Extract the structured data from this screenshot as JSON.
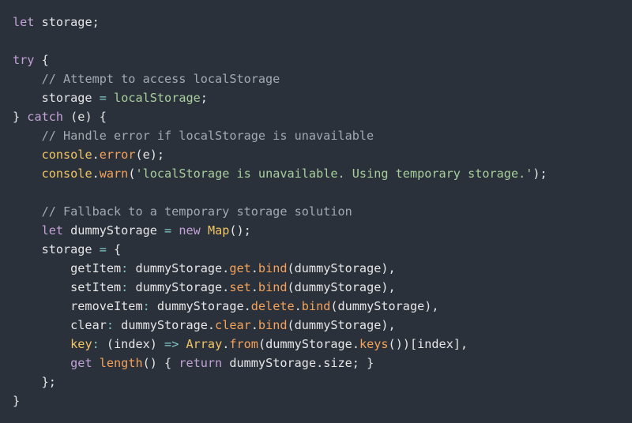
{
  "code": {
    "lines": [
      [
        {
          "t": "let",
          "c": "kw"
        },
        {
          "t": " storage;",
          "c": "pun"
        }
      ],
      [],
      [
        {
          "t": "try",
          "c": "kw"
        },
        {
          "t": " {",
          "c": "pun"
        }
      ],
      [
        {
          "t": "    "
        },
        {
          "t": "// Attempt to access localStorage",
          "c": "cm"
        }
      ],
      [
        {
          "t": "    storage ",
          "c": "ident"
        },
        {
          "t": "=",
          "c": "op"
        },
        {
          "t": " "
        },
        {
          "t": "localStorage",
          "c": "str"
        },
        {
          "t": ";",
          "c": "pun"
        }
      ],
      [
        {
          "t": "} ",
          "c": "pun"
        },
        {
          "t": "catch",
          "c": "kw"
        },
        {
          "t": " (e) {",
          "c": "pun"
        }
      ],
      [
        {
          "t": "    "
        },
        {
          "t": "// Handle error if localStorage is unavailable",
          "c": "cm"
        }
      ],
      [
        {
          "t": "    "
        },
        {
          "t": "console",
          "c": "ty"
        },
        {
          "t": ".",
          "c": "pun"
        },
        {
          "t": "error",
          "c": "fn"
        },
        {
          "t": "(e);",
          "c": "pun"
        }
      ],
      [
        {
          "t": "    "
        },
        {
          "t": "console",
          "c": "ty"
        },
        {
          "t": ".",
          "c": "pun"
        },
        {
          "t": "warn",
          "c": "fn"
        },
        {
          "t": "(",
          "c": "pun"
        },
        {
          "t": "'localStorage is unavailable. Using temporary storage.'",
          "c": "str"
        },
        {
          "t": ");",
          "c": "pun"
        }
      ],
      [],
      [
        {
          "t": "    "
        },
        {
          "t": "// Fallback to a temporary storage solution",
          "c": "cm"
        }
      ],
      [
        {
          "t": "    "
        },
        {
          "t": "let",
          "c": "kw"
        },
        {
          "t": " dummyStorage ",
          "c": "ident"
        },
        {
          "t": "=",
          "c": "op"
        },
        {
          "t": " "
        },
        {
          "t": "new",
          "c": "kw"
        },
        {
          "t": " "
        },
        {
          "t": "Map",
          "c": "ty"
        },
        {
          "t": "();",
          "c": "pun"
        }
      ],
      [
        {
          "t": "    storage ",
          "c": "ident"
        },
        {
          "t": "=",
          "c": "op"
        },
        {
          "t": " {",
          "c": "pun"
        }
      ],
      [
        {
          "t": "        getItem",
          "c": "ident"
        },
        {
          "t": ":",
          "c": "op"
        },
        {
          "t": " dummyStorage.",
          "c": "ident"
        },
        {
          "t": "get",
          "c": "fn"
        },
        {
          "t": ".",
          "c": "pun"
        },
        {
          "t": "bind",
          "c": "fn"
        },
        {
          "t": "(dummyStorage),",
          "c": "pun"
        }
      ],
      [
        {
          "t": "        setItem",
          "c": "ident"
        },
        {
          "t": ":",
          "c": "op"
        },
        {
          "t": " dummyStorage.",
          "c": "ident"
        },
        {
          "t": "set",
          "c": "fn"
        },
        {
          "t": ".",
          "c": "pun"
        },
        {
          "t": "bind",
          "c": "fn"
        },
        {
          "t": "(dummyStorage),",
          "c": "pun"
        }
      ],
      [
        {
          "t": "        removeItem",
          "c": "ident"
        },
        {
          "t": ":",
          "c": "op"
        },
        {
          "t": " dummyStorage.",
          "c": "ident"
        },
        {
          "t": "delete",
          "c": "fn"
        },
        {
          "t": ".",
          "c": "pun"
        },
        {
          "t": "bind",
          "c": "fn"
        },
        {
          "t": "(dummyStorage),",
          "c": "pun"
        }
      ],
      [
        {
          "t": "        clear",
          "c": "ident"
        },
        {
          "t": ":",
          "c": "op"
        },
        {
          "t": " dummyStorage.",
          "c": "ident"
        },
        {
          "t": "clear",
          "c": "fn"
        },
        {
          "t": ".",
          "c": "pun"
        },
        {
          "t": "bind",
          "c": "fn"
        },
        {
          "t": "(dummyStorage),",
          "c": "pun"
        }
      ],
      [
        {
          "t": "        "
        },
        {
          "t": "key",
          "c": "prop"
        },
        {
          "t": ":",
          "c": "op"
        },
        {
          "t": " (index) ",
          "c": "pun"
        },
        {
          "t": "=>",
          "c": "op"
        },
        {
          "t": " "
        },
        {
          "t": "Array",
          "c": "ty"
        },
        {
          "t": ".",
          "c": "pun"
        },
        {
          "t": "from",
          "c": "fn"
        },
        {
          "t": "(dummyStorage.",
          "c": "pun"
        },
        {
          "t": "keys",
          "c": "fn"
        },
        {
          "t": "())[index],",
          "c": "pun"
        }
      ],
      [
        {
          "t": "        "
        },
        {
          "t": "get",
          "c": "kw"
        },
        {
          "t": " "
        },
        {
          "t": "length",
          "c": "fn"
        },
        {
          "t": "() { ",
          "c": "pun"
        },
        {
          "t": "return",
          "c": "kw"
        },
        {
          "t": " dummyStorage.size; }",
          "c": "pun"
        }
      ],
      [
        {
          "t": "    };",
          "c": "pun"
        }
      ],
      [
        {
          "t": "}",
          "c": "pun"
        }
      ]
    ]
  },
  "colors": {
    "background": "#2b313b",
    "keyword": "#c2a2d6",
    "comment": "#a3a8b1",
    "function": "#f4a259",
    "type": "#f2c663",
    "operator": "#7fc8c7",
    "string": "#a7cf9c",
    "text": "#e6e6e6"
  }
}
